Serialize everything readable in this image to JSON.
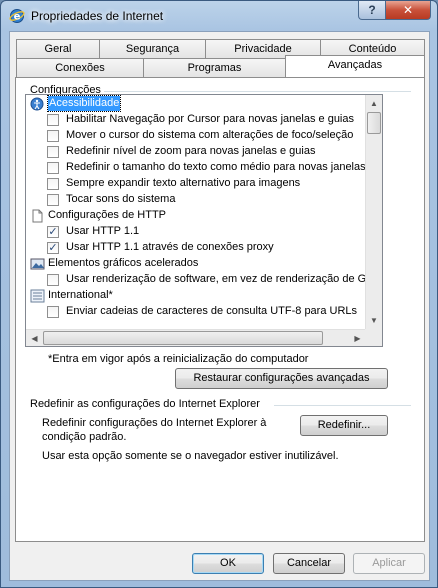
{
  "window": {
    "title": "Propriedades de Internet",
    "help_label": "?",
    "close_label": "✕"
  },
  "tabs": {
    "row1": [
      "Geral",
      "Segurança",
      "Privacidade",
      "Conteúdo"
    ],
    "row2": [
      "Conexões",
      "Programas",
      "Avançadas"
    ],
    "active": "Avançadas"
  },
  "settings": {
    "group_label": "Configurações",
    "items": [
      {
        "kind": "category",
        "icon": "accessibility-icon",
        "label": "Acessibilidade",
        "selected": true
      },
      {
        "kind": "checkbox",
        "checked": false,
        "label": "Habilitar Navegação por Cursor para novas janelas e guias"
      },
      {
        "kind": "checkbox",
        "checked": false,
        "label": "Mover o cursor do sistema com alterações de foco/seleção"
      },
      {
        "kind": "checkbox",
        "checked": false,
        "label": "Redefinir nível de zoom para novas janelas e guias"
      },
      {
        "kind": "checkbox",
        "checked": false,
        "label": "Redefinir o tamanho do texto como médio para novas janelas"
      },
      {
        "kind": "checkbox",
        "checked": false,
        "label": "Sempre expandir texto alternativo para imagens"
      },
      {
        "kind": "checkbox",
        "checked": false,
        "label": "Tocar sons do sistema"
      },
      {
        "kind": "category",
        "icon": "page-icon",
        "label": "Configurações de HTTP",
        "selected": false
      },
      {
        "kind": "checkbox",
        "checked": true,
        "label": "Usar HTTP 1.1"
      },
      {
        "kind": "checkbox",
        "checked": true,
        "label": "Usar HTTP 1.1 através de conexões proxy"
      },
      {
        "kind": "category",
        "icon": "graphics-icon",
        "label": "Elementos gráficos acelerados",
        "selected": false
      },
      {
        "kind": "checkbox",
        "checked": false,
        "label": "Usar renderização de software, em vez de renderização de GPU*"
      },
      {
        "kind": "category",
        "icon": "list-icon",
        "label": "International*",
        "selected": false
      },
      {
        "kind": "checkbox",
        "checked": false,
        "label": "Enviar cadeias de caracteres de consulta UTF-8 para URLs"
      }
    ],
    "footnote": "*Entra em vigor após a reinicialização do computador",
    "restore_button": "Restaurar configurações avançadas"
  },
  "reset": {
    "group_label": "Redefinir as configurações do Internet Explorer",
    "description_line1": "Redefinir configurações do Internet Explorer à",
    "description_line2": "condição padrão.",
    "reset_button": "Redefinir...",
    "note": "Usar esta opção somente se o navegador estiver inutilizável."
  },
  "footer": {
    "ok": "OK",
    "cancel": "Cancelar",
    "apply": "Aplicar"
  }
}
